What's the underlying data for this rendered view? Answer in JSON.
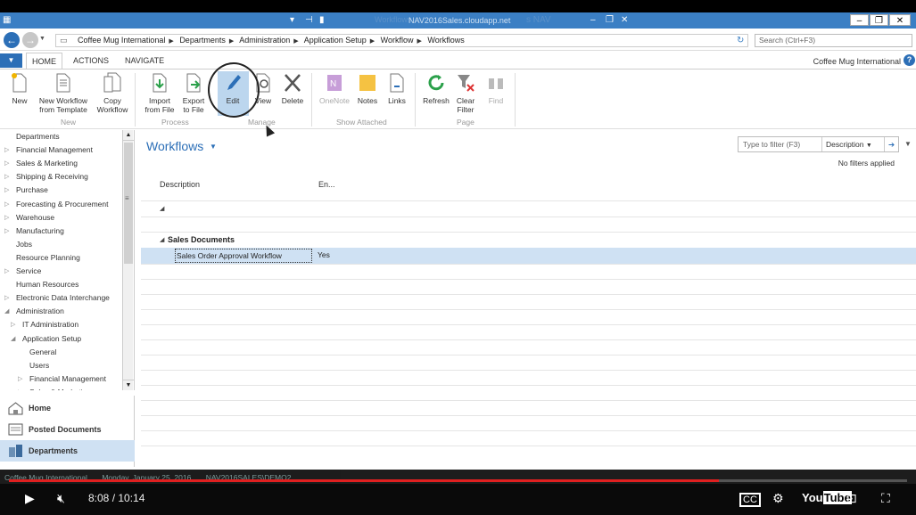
{
  "window": {
    "title": "NAV2016Sales.cloudapp.net",
    "title_overlay": "Workflows",
    "title_overlay_right": "s NAV"
  },
  "nav": {
    "breadcrumb": [
      "Coffee Mug International",
      "Departments",
      "Administration",
      "Application Setup",
      "Workflow",
      "Workflows"
    ],
    "search_placeholder": "Search (Ctrl+F3)"
  },
  "ribbon": {
    "tabs": [
      "HOME",
      "ACTIONS",
      "NAVIGATE"
    ],
    "company": "Coffee Mug International",
    "groups": {
      "new": "New",
      "process": "Process",
      "manage": "Manage",
      "show_attached": "Show Attached",
      "page": "Page"
    },
    "buttons": {
      "new": "New",
      "new_from_template": [
        "New Workflow",
        "from Template"
      ],
      "copy_workflow": [
        "Copy",
        "Workflow"
      ],
      "import_from_file": [
        "Import",
        "from File"
      ],
      "export_to_file": [
        "Export",
        "to File"
      ],
      "edit": "Edit",
      "view": "View",
      "delete": "Delete",
      "onenote": "OneNote",
      "notes": "Notes",
      "links": "Links",
      "refresh": "Refresh",
      "clear_filter": [
        "Clear",
        "Filter"
      ],
      "find": "Find"
    }
  },
  "sidebar": {
    "items": [
      {
        "label": "Departments",
        "level": 0,
        "arrow": ""
      },
      {
        "label": "Financial Management",
        "level": 0,
        "arrow": "closed"
      },
      {
        "label": "Sales & Marketing",
        "level": 0,
        "arrow": "closed"
      },
      {
        "label": "Shipping & Receiving",
        "level": 0,
        "arrow": "closed"
      },
      {
        "label": "Purchase",
        "level": 0,
        "arrow": "closed"
      },
      {
        "label": "Forecasting & Procurement",
        "level": 0,
        "arrow": "closed"
      },
      {
        "label": "Warehouse",
        "level": 0,
        "arrow": "closed"
      },
      {
        "label": "Manufacturing",
        "level": 0,
        "arrow": "closed"
      },
      {
        "label": "Jobs",
        "level": 0,
        "arrow": ""
      },
      {
        "label": "Resource Planning",
        "level": 0,
        "arrow": ""
      },
      {
        "label": "Service",
        "level": 0,
        "arrow": "closed"
      },
      {
        "label": "Human Resources",
        "level": 0,
        "arrow": ""
      },
      {
        "label": "Electronic Data Interchange",
        "level": 0,
        "arrow": "closed"
      },
      {
        "label": "Administration",
        "level": 0,
        "arrow": "open"
      },
      {
        "label": "IT Administration",
        "level": 1,
        "arrow": "closed"
      },
      {
        "label": "Application Setup",
        "level": 1,
        "arrow": "open"
      },
      {
        "label": "General",
        "level": 2,
        "arrow": ""
      },
      {
        "label": "Users",
        "level": 2,
        "arrow": ""
      },
      {
        "label": "Financial Management",
        "level": 2,
        "arrow": "closed"
      },
      {
        "label": "Sales & Marketing",
        "level": 2,
        "arrow": "closed"
      }
    ],
    "nav_buttons": [
      "Home",
      "Posted Documents",
      "Departments"
    ]
  },
  "main": {
    "title": "Workflows",
    "filter_placeholder": "Type to filter (F3)",
    "filter_field": "Description",
    "no_filters": "No filters applied",
    "columns": [
      "Description",
      "En..."
    ],
    "group": "Sales Documents",
    "rows": [
      {
        "description": "Sales Order Approval Workflow",
        "enabled": "Yes"
      }
    ]
  },
  "status_bar": {
    "company": "Coffee Mug International",
    "date": "Monday, January 25, 2016",
    "server": "NAV2016SALES\\DEMO2"
  },
  "video": {
    "time": "8:08 / 10:14",
    "progress": 0.79,
    "accent": "#e02020"
  }
}
